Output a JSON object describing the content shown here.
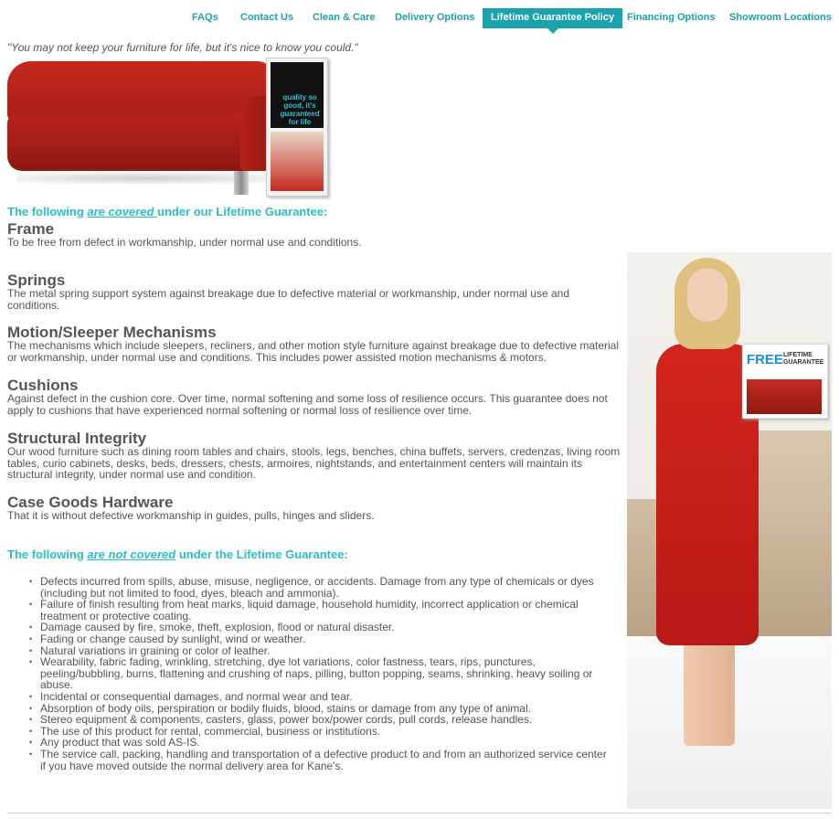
{
  "nav": {
    "items": [
      {
        "label": "FAQs",
        "active": false
      },
      {
        "label": "Contact Us",
        "active": false
      },
      {
        "label": "Clean & Care",
        "active": false
      },
      {
        "label": "Delivery Options",
        "active": false
      },
      {
        "label": "Lifetime Guarantee Policy",
        "active": true
      },
      {
        "label": "Financing Options",
        "active": false
      },
      {
        "label": "Showroom Locations",
        "active": false
      }
    ]
  },
  "quote": "\"You may not keep your furniture for life, but it's nice to know you could.\"",
  "hero_brochure": {
    "text": "quality so good, it's guaranteed for life"
  },
  "covered_intro": {
    "pre": "The following ",
    "em": "are covered ",
    "post": "under our Lifetime Guarantee:"
  },
  "sections": [
    {
      "title": "Frame",
      "body": "To be free from defect in workmanship, under normal use and conditions."
    },
    {
      "title": "Springs",
      "body": "The metal spring support system against breakage due to defective material or workmanship, under normal use and conditions."
    },
    {
      "title": "Motion/Sleeper Mechanisms",
      "body": "The mechanisms which include sleepers, recliners, and other motion style furniture against breakage due to defective material or workmanship, under normal use and conditions. This includes power assisted motion mechanisms & motors."
    },
    {
      "title": "Cushions",
      "body": "Against defect in the cushion core.  Over time, normal softening and some loss of resilience occurs.  This guarantee does not apply to cushions that have experienced normal softening or normal loss of resilience over time."
    },
    {
      "title": "Structural Integrity",
      "body": "Our wood furniture such as dining room tables and chairs, stools, legs, benches, china buffets, servers, credenzas, living room tables, curio cabinets, desks, beds, dressers, chests, armoires, nightstands, and entertainment centers will maintain its structural integrity, under normal use and condition."
    },
    {
      "title": "Case Goods Hardware",
      "body": "That it is without defective workmanship in guides, pulls, hinges and sliders."
    }
  ],
  "not_covered_intro": {
    "pre": "The following ",
    "em": "are not covered",
    "post": " under the Lifetime Guarantee:"
  },
  "exclusions": [
    "Defects incurred from spills, abuse, misuse, negligence, or accidents. Damage from any type of chemicals or dyes (including but not limited to food, dyes, bleach and ammonia).",
    "Failure of finish resulting from heat marks, liquid damage, household humidity, incorrect application or chemical treatment or protective coating.",
    "Damage caused by fire, smoke, theft, explosion, flood or natural disaster.",
    "Fading or change caused by sunlight, wind or weather.",
    "Natural variations in graining or color of leather.",
    "Wearability, fabric fading, wrinkling, stretching, dye lot variations, color fastness, tears, rips, punctures, peeling/bubbling, burns, flattening and crushing of naps, pilling, button popping, seams, shrinking, heavy soiling or abuse.",
    "Incidental or consequential damages, and normal wear and tear.",
    "Absorption of body oils, perspiration or bodily fluids, blood, stains or damage from any type of animal.",
    "Stereo equipment & components, casters, glass, power box/power cords, pull cords, release handles.",
    "The use of this product for rental, commercial, business or institutions.",
    "Any product that was sold AS-IS.",
    "The service call, packing, handling and transportation of a defective product to and from an authorized service center if you have moved outside the normal delivery area for Kane's."
  ],
  "promo_card": {
    "free": "FREE",
    "label": "LIFETIME GUARANTEE"
  },
  "colors": {
    "accent": "#1aa3ad",
    "heading": "#2bbfc6",
    "text": "#555555"
  }
}
